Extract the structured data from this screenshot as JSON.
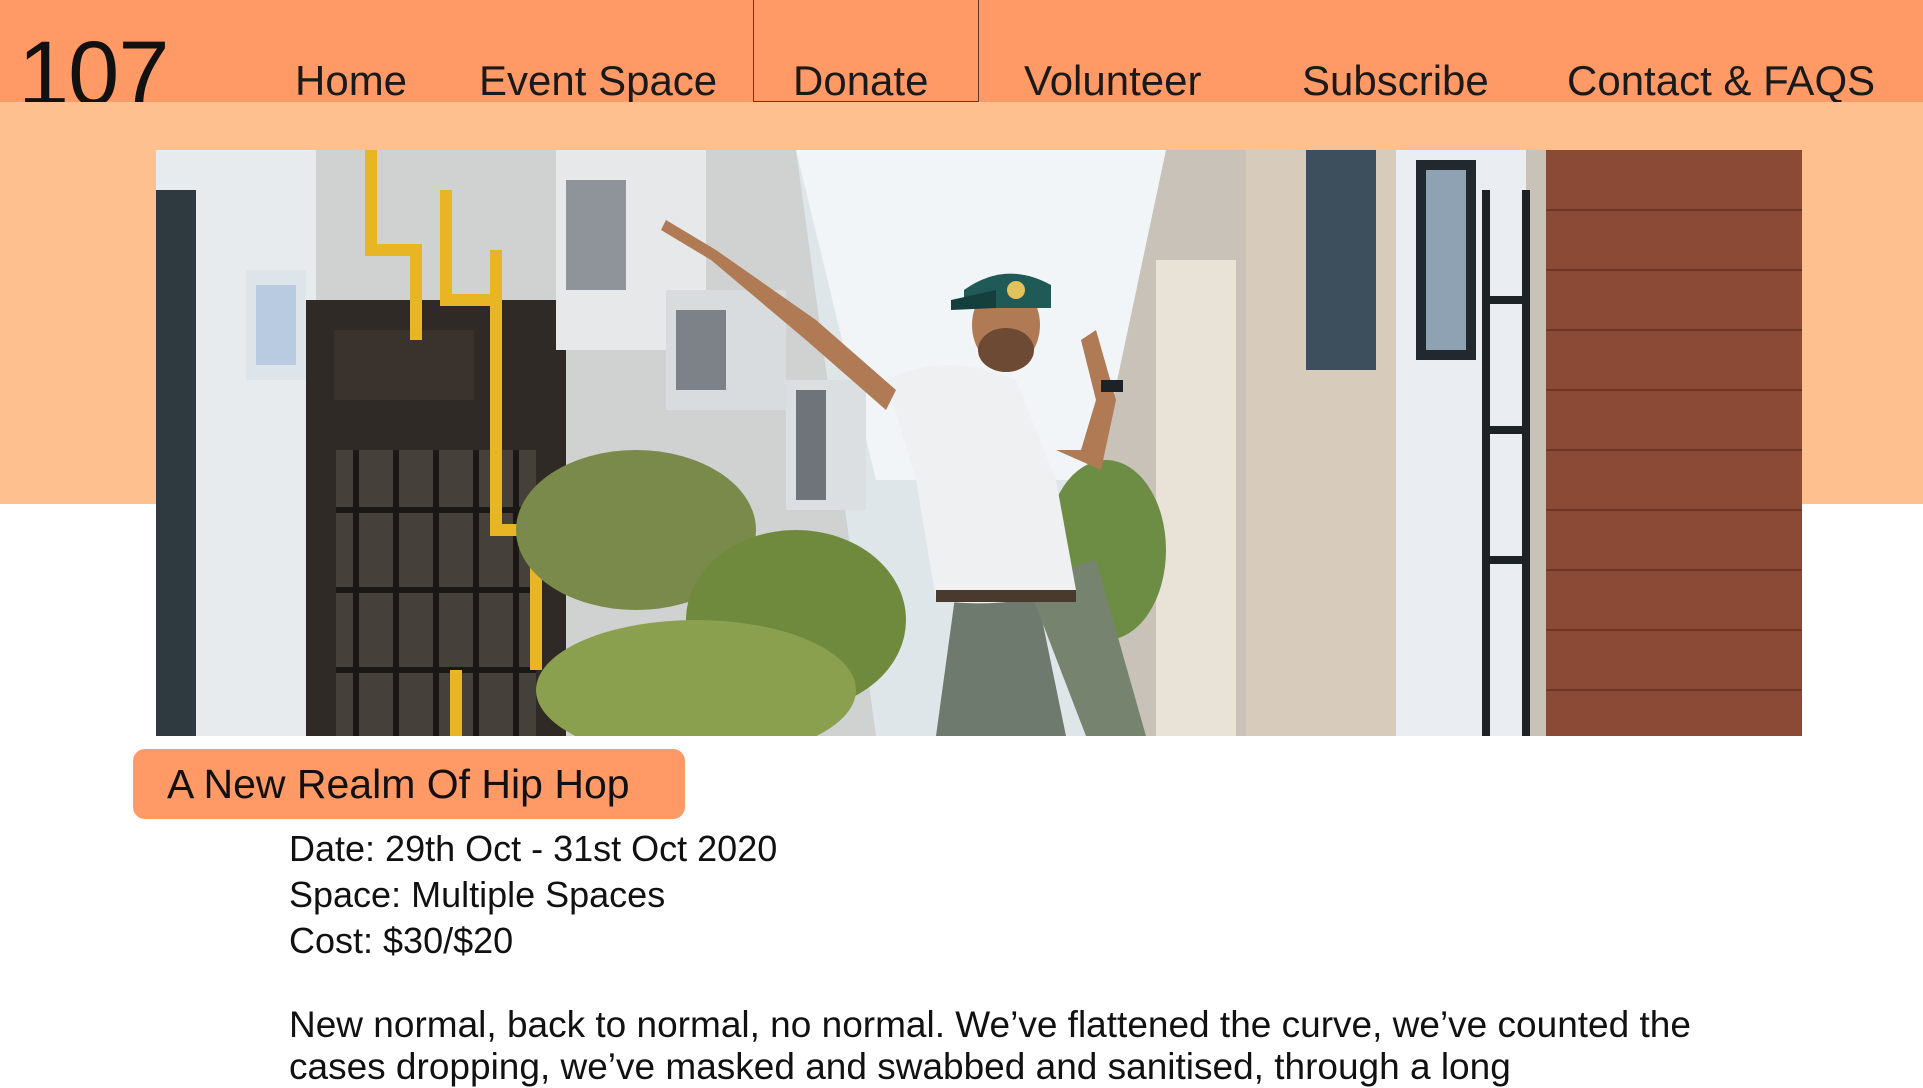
{
  "header": {
    "logo": "107",
    "nav": [
      {
        "label": "Home"
      },
      {
        "label": "Event Space"
      },
      {
        "label": "Donate"
      },
      {
        "label": "Volunteer"
      },
      {
        "label": "Subscribe"
      },
      {
        "label": "Contact & FAQS"
      }
    ],
    "active_item": "Donate"
  },
  "hero": {
    "image": "street-dancer-photo"
  },
  "event": {
    "title": "A New Realm Of Hip Hop",
    "date": "Date: 29th Oct - 31st Oct 2020",
    "space": "Space: Multiple Spaces",
    "cost": "Cost: $30/$20",
    "description": "New normal, back to normal, no normal. We’ve flattened the curve, we’ve counted the cases dropping, we’ve masked and swabbed and sanitised, through a long"
  },
  "colors": {
    "nav_bg": "#ff9966",
    "band_bg": "#ffc08f",
    "pill_bg": "#ff9966",
    "text": "#111111"
  }
}
